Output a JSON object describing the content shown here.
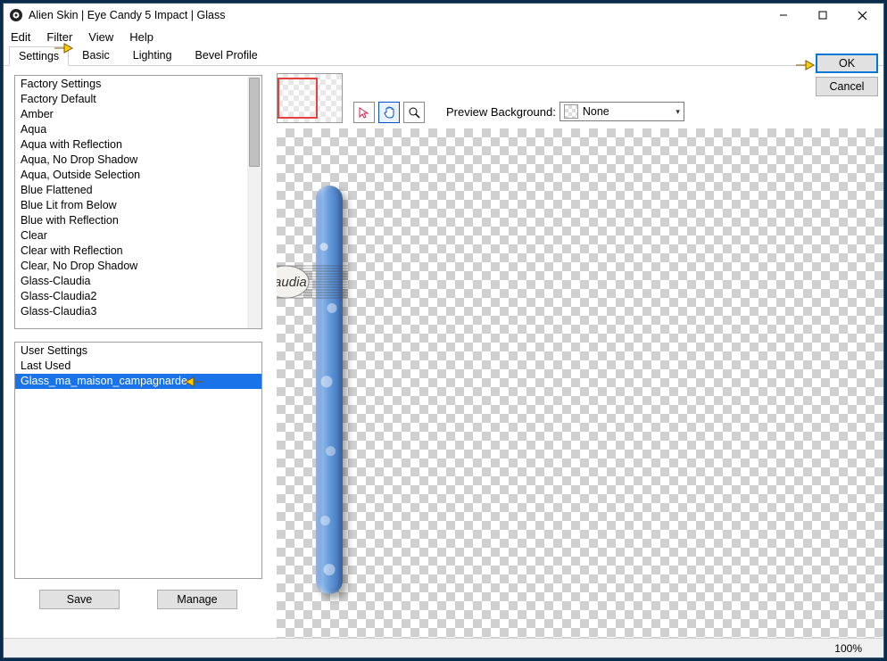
{
  "title": "Alien Skin | Eye Candy 5 Impact | Glass",
  "menu": {
    "edit": "Edit",
    "filter": "Filter",
    "view": "View",
    "help": "Help"
  },
  "tabs": {
    "settings": "Settings",
    "basic": "Basic",
    "lighting": "Lighting",
    "bevel": "Bevel Profile"
  },
  "factory": {
    "header": "Factory Settings",
    "items": [
      "Factory Default",
      "Amber",
      "Aqua",
      "Aqua with Reflection",
      "Aqua, No Drop Shadow",
      "Aqua, Outside Selection",
      "Blue Flattened",
      "Blue Lit from Below",
      "Blue with Reflection",
      "Clear",
      "Clear with Reflection",
      "Clear, No Drop Shadow",
      "Glass-Claudia",
      "Glass-Claudia2",
      "Glass-Claudia3"
    ]
  },
  "user": {
    "header": "User Settings",
    "items": [
      "Last Used",
      "Glass_ma_maison_campagnarde"
    ],
    "selected": 1
  },
  "buttons": {
    "save": "Save",
    "manage": "Manage",
    "ok": "OK",
    "cancel": "Cancel"
  },
  "preview": {
    "label": "Preview Background:",
    "value": "None"
  },
  "status": {
    "zoom": "100%"
  },
  "watermark": "claudia"
}
